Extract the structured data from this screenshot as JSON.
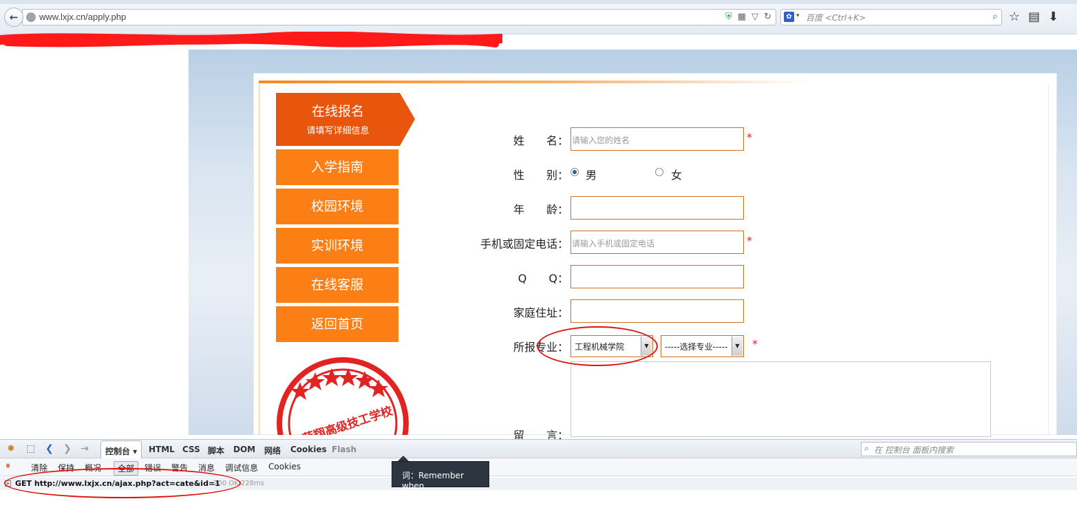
{
  "browser": {
    "url": "www.lxjx.cn/apply.php",
    "search_placeholder": "百度 <Ctrl+K>",
    "search_engine_icon": "baidu-paw-icon"
  },
  "sidebar": {
    "header_title": "在线报名",
    "header_subtitle": "请填写详细信息",
    "items": [
      {
        "label": "入学指南"
      },
      {
        "label": "校园环境"
      },
      {
        "label": "实训环境"
      },
      {
        "label": "在线客服"
      },
      {
        "label": "返回首页"
      }
    ],
    "stamp_text": "山东蓝翔高级技工学校 · 职业教育第一品牌"
  },
  "form": {
    "name_label": "姓　　名：",
    "name_placeholder": "请输入您的姓名",
    "gender_label": "性　　别：",
    "gender_male": "男",
    "gender_female": "女",
    "gender_selected": "男",
    "age_label": "年　　龄：",
    "phone_label": "手机或固定电话：",
    "phone_placeholder": "请输入手机或固定电话",
    "qq_label": "Q　　Q：",
    "address_label": "家庭住址：",
    "major_label": "所报专业：",
    "college_value": "工程机械学院",
    "major_value": "-----选择专业-----",
    "message_label": "留　　言：",
    "required_mark": "*"
  },
  "devtools": {
    "tabs": [
      {
        "label": "控制台 ▾",
        "active": true
      },
      {
        "label": "HTML"
      },
      {
        "label": "CSS"
      },
      {
        "label": "脚本"
      },
      {
        "label": "DOM"
      },
      {
        "label": "网络"
      },
      {
        "label": "Cookies"
      },
      {
        "label": "Flash",
        "dim": true
      }
    ],
    "search_placeholder": "在 控制台 面板内搜索",
    "sub_buttons": [
      "清除",
      "保持",
      "概况",
      "全部",
      "错误",
      "警告",
      "消息",
      "调试信息",
      "Cookies"
    ],
    "active_sub": "全部",
    "log_request": "GET http://www.lxjx.cn/ajax.php?act=cate&id=1",
    "log_status": "200 OK 228ms",
    "tooltip": "词：Remember when"
  },
  "colors": {
    "accent_orange": "#fb7f15",
    "header_orange": "#e8560e",
    "annotation_red": "#e01010"
  }
}
